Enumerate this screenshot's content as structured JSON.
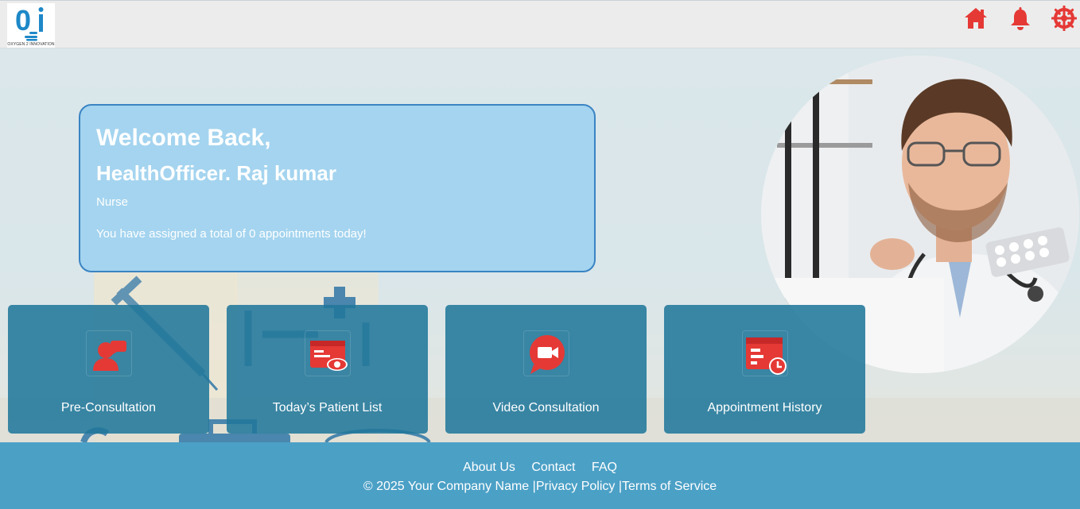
{
  "header": {
    "logo_text": "OXYGEN 2 INNOVATION",
    "icons": [
      "home-icon",
      "bell-icon",
      "settings-icon"
    ]
  },
  "welcome": {
    "title": "Welcome Back,",
    "name": "HealthOfficer. Raj kumar",
    "role": "Nurse",
    "message": "You have assigned a total of 0 appointments today!"
  },
  "tiles": [
    {
      "label": "Pre-Consultation",
      "icon": "user-chat-icon"
    },
    {
      "label": "Today’s Patient List",
      "icon": "patient-list-eye-icon"
    },
    {
      "label": "Video Consultation",
      "icon": "video-chat-icon"
    },
    {
      "label": "Appointment History",
      "icon": "calendar-clock-icon"
    }
  ],
  "footer": {
    "links": [
      "About Us",
      "Contact",
      "FAQ"
    ],
    "copyright": "© 2025 Your Company Name |",
    "privacy": "Privacy Policy |",
    "terms": "Terms of Service"
  },
  "colors": {
    "accent_red": "#e53935",
    "tile_bg": "#21789b",
    "footer_bg": "#4ba0c6",
    "card_bg": "#a4d4ef",
    "card_border": "#3a84c3"
  }
}
